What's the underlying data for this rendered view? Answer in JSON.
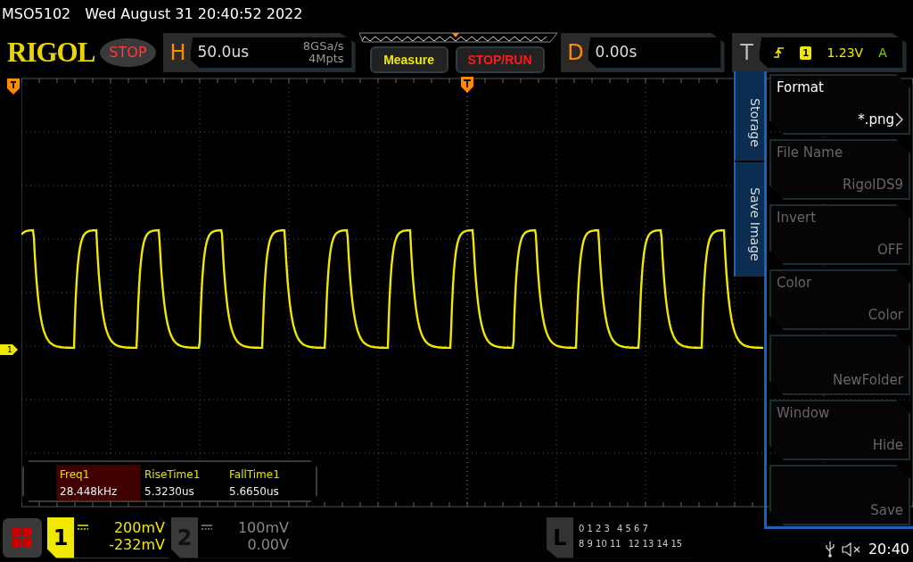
{
  "title_bar": {
    "model": "MSO5102",
    "datetime": "Wed August 31 20:40:52 2022"
  },
  "header": {
    "logo": "RIGOL",
    "run_state": "STOP",
    "horizontal": {
      "label": "H",
      "timebase": "50.0us",
      "sample_rate": "8GSa/s",
      "memory_depth": "4Mpts"
    },
    "buttons": [
      {
        "label": "Measure",
        "kind": "measure"
      },
      {
        "label": "STOP/RUN",
        "kind": "stoprun"
      }
    ],
    "delay": {
      "label": "D",
      "value": "0.00s"
    },
    "trigger": {
      "label": "T",
      "source": "1",
      "level": "1.23V",
      "mode": "A"
    }
  },
  "plot": {
    "channel_marker": "1"
  },
  "measurements": [
    {
      "name": "Freq1",
      "value": "28.448kHz",
      "selected": true
    },
    {
      "name": "RiseTime1",
      "value": "5.3230us",
      "selected": false
    },
    {
      "name": "FallTime1",
      "value": "5.6650us",
      "selected": false
    }
  ],
  "side_menu": {
    "tabs": [
      "Storage",
      "Save Image"
    ],
    "items": [
      {
        "label": "Format",
        "value": "*.png",
        "disabled": false,
        "submenu": true
      },
      {
        "label": "File Name",
        "value": "RigolDS9",
        "disabled": true,
        "submenu": false
      },
      {
        "label": "Invert",
        "value": "OFF",
        "disabled": true,
        "submenu": false
      },
      {
        "label": "Color",
        "value": "Color",
        "disabled": true,
        "submenu": false
      },
      {
        "value": "NewFolder",
        "disabled": true,
        "submenu": false
      },
      {
        "label": "Window",
        "value": "Hide",
        "disabled": true,
        "submenu": false
      },
      {
        "value": "Save",
        "disabled": true,
        "submenu": false
      }
    ]
  },
  "channels": [
    {
      "number": "1",
      "scale": "200mV",
      "offset": "-232mV",
      "active": true
    },
    {
      "number": "2",
      "scale": "100mV",
      "offset": "0.00V",
      "active": false
    }
  ],
  "logic": {
    "label": "L",
    "rows": [
      [
        "0 1 2 3",
        "4 5 6 7"
      ],
      [
        "8 9 10 11",
        "12 13 14 15"
      ]
    ]
  },
  "status_bar": {
    "muted": true,
    "time": "20:40"
  }
}
